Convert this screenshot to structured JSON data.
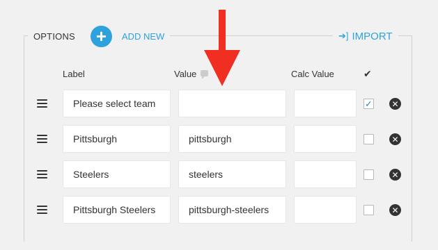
{
  "options": {
    "title": "OPTIONS",
    "add_label": "ADD NEW",
    "import_label": "IMPORT"
  },
  "columns": {
    "label": "Label",
    "value": "Value",
    "calc_value": "Calc Value",
    "selected": "✔"
  },
  "rows": [
    {
      "label": "Please select team",
      "value": "",
      "calc_value": "",
      "checked": true
    },
    {
      "label": "Pittsburgh",
      "value": "pittsburgh",
      "calc_value": "",
      "checked": false
    },
    {
      "label": "Steelers",
      "value": "steelers",
      "calc_value": "",
      "checked": false
    },
    {
      "label": "Pittsburgh Steelers",
      "value": "pittsburgh-steelers",
      "calc_value": "",
      "checked": false
    }
  ],
  "colors": {
    "accent": "#2ea2dc",
    "arrow": "#f02e22"
  }
}
